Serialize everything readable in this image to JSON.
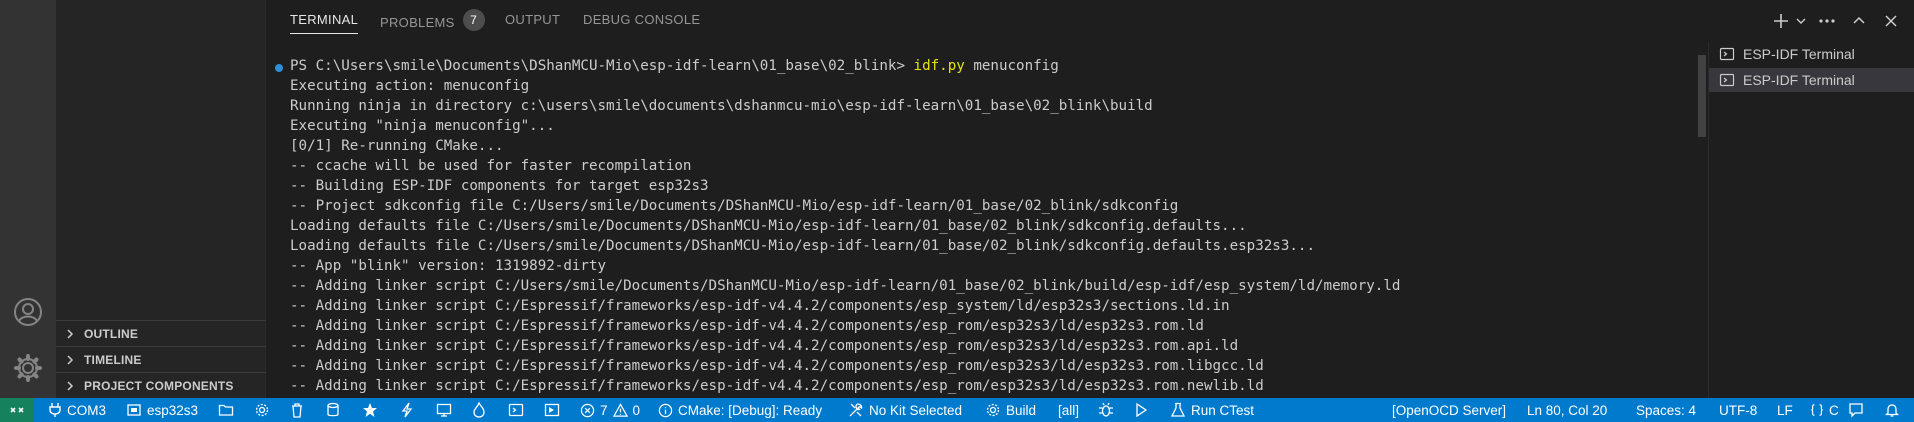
{
  "sidebar": {
    "sections": [
      {
        "label": "OUTLINE"
      },
      {
        "label": "TIMELINE"
      },
      {
        "label": "PROJECT COMPONENTS"
      }
    ]
  },
  "panel": {
    "tabs": [
      {
        "label": "TERMINAL",
        "active": true
      },
      {
        "label": "PROBLEMS",
        "badge": "7"
      },
      {
        "label": "OUTPUT"
      },
      {
        "label": "DEBUG CONSOLE"
      }
    ]
  },
  "terminal": {
    "prompt": "PS C:\\Users\\smile\\Documents\\DShanMCU-Mio\\esp-idf-learn\\01_base\\02_blink> ",
    "command": "idf.py",
    "command_args": " menuconfig",
    "lines": [
      "Executing action: menuconfig",
      "Running ninja in directory c:\\users\\smile\\documents\\dshanmcu-mio\\esp-idf-learn\\01_base\\02_blink\\build",
      "Executing \"ninja menuconfig\"...",
      "[0/1] Re-running CMake...",
      "-- ccache will be used for faster recompilation",
      "-- Building ESP-IDF components for target esp32s3",
      "-- Project sdkconfig file C:/Users/smile/Documents/DShanMCU-Mio/esp-idf-learn/01_base/02_blink/sdkconfig",
      "Loading defaults file C:/Users/smile/Documents/DShanMCU-Mio/esp-idf-learn/01_base/02_blink/sdkconfig.defaults...",
      "Loading defaults file C:/Users/smile/Documents/DShanMCU-Mio/esp-idf-learn/01_base/02_blink/sdkconfig.defaults.esp32s3...",
      "-- App \"blink\" version: 1319892-dirty",
      "-- Adding linker script C:/Users/smile/Documents/DShanMCU-Mio/esp-idf-learn/01_base/02_blink/build/esp-idf/esp_system/ld/memory.ld",
      "-- Adding linker script C:/Espressif/frameworks/esp-idf-v4.4.2/components/esp_system/ld/esp32s3/sections.ld.in",
      "-- Adding linker script C:/Espressif/frameworks/esp-idf-v4.4.2/components/esp_rom/esp32s3/ld/esp32s3.rom.ld",
      "-- Adding linker script C:/Espressif/frameworks/esp-idf-v4.4.2/components/esp_rom/esp32s3/ld/esp32s3.rom.api.ld",
      "-- Adding linker script C:/Espressif/frameworks/esp-idf-v4.4.2/components/esp_rom/esp32s3/ld/esp32s3.rom.libgcc.ld",
      "-- Adding linker script C:/Espressif/frameworks/esp-idf-v4.4.2/components/esp_rom/esp32s3/ld/esp32s3.rom.newlib.ld"
    ],
    "instances": [
      {
        "label": "ESP-IDF Terminal",
        "selected": false
      },
      {
        "label": "ESP-IDF Terminal",
        "selected": true
      }
    ]
  },
  "statusbar": {
    "port": "COM3",
    "target": "esp32s3",
    "errors": "7",
    "warnings": "0",
    "cmake": "CMake: [Debug]: Ready",
    "kit": "No Kit Selected",
    "build": "Build",
    "build_target": "[all]",
    "ctest": "Run CTest",
    "openocd": "[OpenOCD Server]",
    "cursor": "Ln 80, Col 20",
    "spaces": "Spaces: 4",
    "encoding": "UTF-8",
    "eol": "LF",
    "language": "C"
  },
  "colors": {
    "statusbar": "#007acc",
    "remote": "#16825d",
    "command": "#e5e510",
    "prompt_dot": "#2f8fd6"
  }
}
